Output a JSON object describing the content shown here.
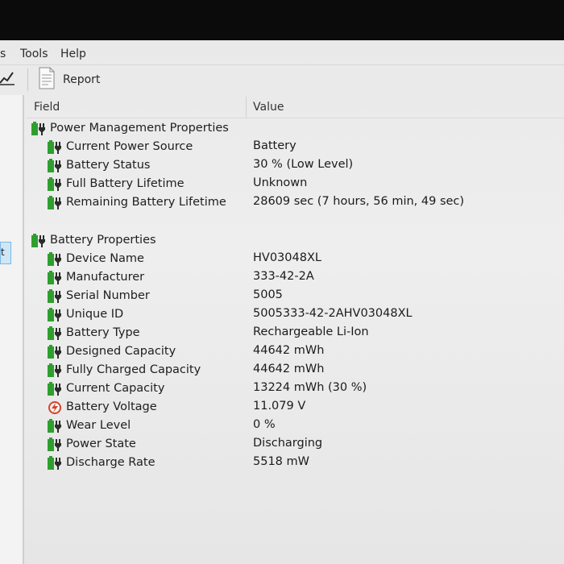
{
  "menu": {
    "items": [
      {
        "label": "s"
      },
      {
        "label": "Tools"
      },
      {
        "label": "Help"
      }
    ]
  },
  "toolbar": {
    "report_label": "Report"
  },
  "left_pane": {
    "selected_label": "t"
  },
  "columns": {
    "field": "Field",
    "value": "Value"
  },
  "sections": [
    {
      "title": "Power Management Properties",
      "icon": "battery-plug-icon",
      "rows": [
        {
          "field": "Current Power Source",
          "value": "Battery",
          "icon": "battery-plug-icon"
        },
        {
          "field": "Battery Status",
          "value": "30 % (Low Level)",
          "icon": "battery-plug-icon"
        },
        {
          "field": "Full Battery Lifetime",
          "value": "Unknown",
          "icon": "battery-plug-icon"
        },
        {
          "field": "Remaining Battery Lifetime",
          "value": "28609 sec (7 hours, 56 min, 49 sec)",
          "icon": "battery-plug-icon"
        }
      ]
    },
    {
      "title": "Battery Properties",
      "icon": "battery-plug-icon",
      "rows": [
        {
          "field": "Device Name",
          "value": "HV03048XL",
          "icon": "battery-plug-icon"
        },
        {
          "field": "Manufacturer",
          "value": "333-42-2A",
          "icon": "battery-plug-icon"
        },
        {
          "field": "Serial Number",
          "value": "5005",
          "icon": "battery-plug-icon"
        },
        {
          "field": "Unique ID",
          "value": "5005333-42-2AHV03048XL",
          "icon": "battery-plug-icon"
        },
        {
          "field": "Battery Type",
          "value": "Rechargeable Li-Ion",
          "icon": "battery-plug-icon"
        },
        {
          "field": "Designed Capacity",
          "value": "44642 mWh",
          "icon": "battery-plug-icon"
        },
        {
          "field": "Fully Charged Capacity",
          "value": "44642 mWh",
          "icon": "battery-plug-icon"
        },
        {
          "field": "Current Capacity",
          "value": "13224 mWh  (30 %)",
          "icon": "battery-plug-icon"
        },
        {
          "field": "Battery Voltage",
          "value": "11.079 V",
          "icon": "voltage-icon"
        },
        {
          "field": "Wear Level",
          "value": "0 %",
          "icon": "battery-plug-icon"
        },
        {
          "field": "Power State",
          "value": "Discharging",
          "icon": "battery-plug-icon"
        },
        {
          "field": "Discharge Rate",
          "value": "5518 mW",
          "icon": "battery-plug-icon"
        }
      ]
    }
  ],
  "colors": {
    "battery_green": "#2f9e2f",
    "plug": "#2b2b2b",
    "voltage_red": "#d8432b"
  }
}
